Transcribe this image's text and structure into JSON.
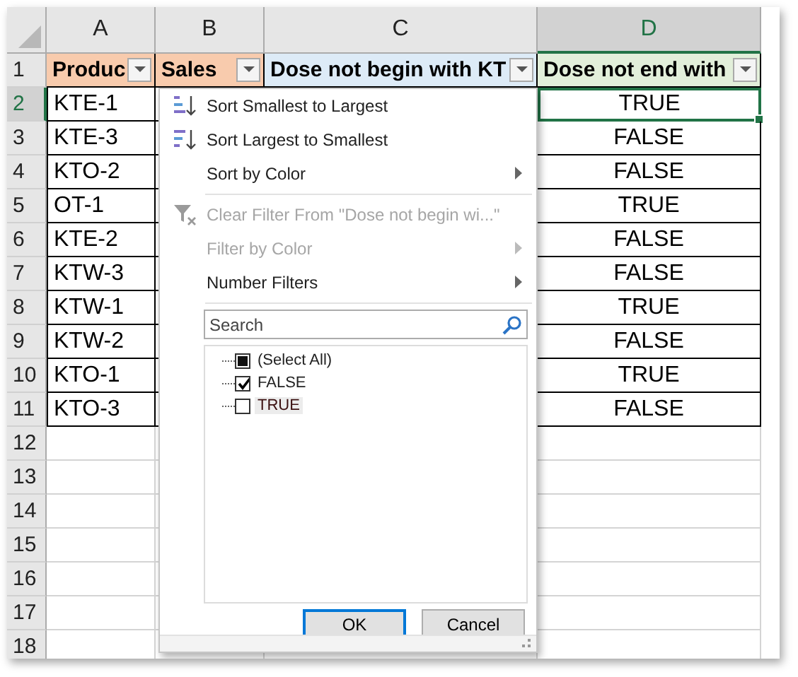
{
  "column_headers": [
    {
      "label": "A",
      "selected": false
    },
    {
      "label": "B",
      "selected": false
    },
    {
      "label": "C",
      "selected": false
    },
    {
      "label": "D",
      "selected": true
    }
  ],
  "row_headers": [
    {
      "label": "1",
      "selected": false
    },
    {
      "label": "2",
      "selected": true
    },
    {
      "label": "3",
      "selected": false
    },
    {
      "label": "4",
      "selected": false
    },
    {
      "label": "5",
      "selected": false
    },
    {
      "label": "6",
      "selected": false
    },
    {
      "label": "7",
      "selected": false
    },
    {
      "label": "8",
      "selected": false
    },
    {
      "label": "9",
      "selected": false
    },
    {
      "label": "10",
      "selected": false
    },
    {
      "label": "11",
      "selected": false
    },
    {
      "label": "12",
      "selected": false
    },
    {
      "label": "13",
      "selected": false
    },
    {
      "label": "14",
      "selected": false
    },
    {
      "label": "15",
      "selected": false
    },
    {
      "label": "16",
      "selected": false
    },
    {
      "label": "17",
      "selected": false
    },
    {
      "label": "18",
      "selected": false
    }
  ],
  "header_row": [
    {
      "text": "Produc",
      "color": "#f8cbad"
    },
    {
      "text": "Sales",
      "color": "#f8cbad"
    },
    {
      "text": "Dose not begin with KT",
      "color": "#ddebf7"
    },
    {
      "text": "Dose not end with",
      "color": "#e2efda"
    }
  ],
  "rows": [
    {
      "product": "KTE-1",
      "dose_not_end_with": "TRUE"
    },
    {
      "product": "KTE-3",
      "dose_not_end_with": "FALSE"
    },
    {
      "product": "KTO-2",
      "dose_not_end_with": "FALSE"
    },
    {
      "product": "OT-1",
      "dose_not_end_with": "TRUE"
    },
    {
      "product": "KTE-2",
      "dose_not_end_with": "FALSE"
    },
    {
      "product": "KTW-3",
      "dose_not_end_with": "FALSE"
    },
    {
      "product": "KTW-1",
      "dose_not_end_with": "TRUE"
    },
    {
      "product": "KTW-2",
      "dose_not_end_with": "FALSE"
    },
    {
      "product": "KTO-1",
      "dose_not_end_with": "TRUE"
    },
    {
      "product": "KTO-3",
      "dose_not_end_with": "FALSE"
    }
  ],
  "filter_menu": {
    "items": [
      {
        "kind": "sort-ascending",
        "label": "Sort Smallest to Largest",
        "disabled": false,
        "submenu": false
      },
      {
        "kind": "sort-descending",
        "label": "Sort Largest to Smallest",
        "disabled": false,
        "submenu": false
      },
      {
        "kind": "plain",
        "label": "Sort by Color",
        "disabled": false,
        "submenu": true
      },
      {
        "kind": "separator"
      },
      {
        "kind": "clear-filter",
        "label": "Clear Filter From \"Dose not begin wi...\"",
        "disabled": true,
        "submenu": false
      },
      {
        "kind": "plain",
        "label": "Filter by Color",
        "disabled": true,
        "submenu": true
      },
      {
        "kind": "plain",
        "label": "Number Filters",
        "disabled": false,
        "submenu": true
      },
      {
        "kind": "separator"
      }
    ],
    "search": {
      "placeholder": "Search"
    },
    "values": [
      {
        "label": "(Select All)",
        "checked": true,
        "mixed": true,
        "selected": false
      },
      {
        "label": "FALSE",
        "checked": true,
        "mixed": false,
        "selected": false
      },
      {
        "label": "TRUE",
        "checked": false,
        "selected": true
      }
    ],
    "buttons": [
      {
        "label": "OK",
        "default": true
      },
      {
        "label": "Cancel",
        "default": false
      }
    ]
  }
}
